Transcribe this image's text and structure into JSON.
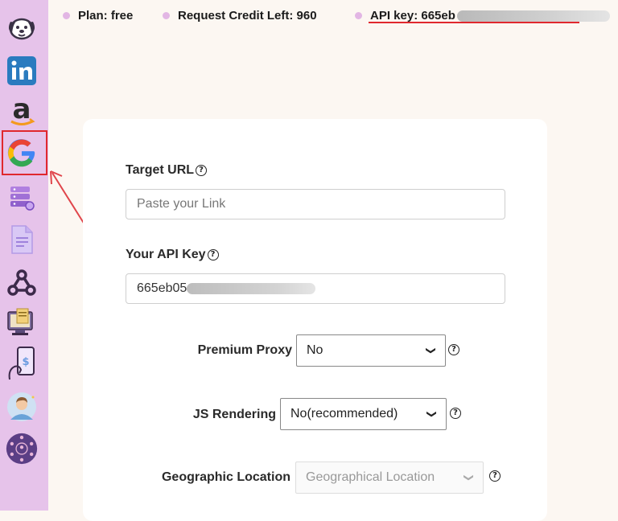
{
  "topbar": {
    "plan": "Plan: free",
    "credit": "Request Credit Left: 960",
    "apikey": "API key: 665eb"
  },
  "sidebar": {
    "items": [
      {
        "name": "dog-logo-icon"
      },
      {
        "name": "linkedin-icon"
      },
      {
        "name": "amazon-icon"
      },
      {
        "name": "google-icon",
        "selected": true
      },
      {
        "name": "server-database-icon"
      },
      {
        "name": "document-icon"
      },
      {
        "name": "webhook-icon"
      },
      {
        "name": "screen-scraper-icon"
      },
      {
        "name": "mobile-pricing-icon"
      },
      {
        "name": "user-avatar-icon"
      },
      {
        "name": "network-people-icon"
      }
    ]
  },
  "form": {
    "target_url_label": "Target URL",
    "target_url_placeholder": "Paste your Link",
    "api_key_label": "Your API Key",
    "api_key_value": "665eb05",
    "premium_proxy_label": "Premium Proxy",
    "premium_proxy_value": "No",
    "js_rendering_label": "JS Rendering",
    "js_rendering_value": "No(recommended)",
    "geo_label": "Geographic Location",
    "geo_value": "Geographical Location",
    "help_glyph": "?"
  },
  "colors": {
    "sidebar": "#e6c3ea",
    "page_bg": "#fcf7f2",
    "highlight": "#e0282e"
  }
}
